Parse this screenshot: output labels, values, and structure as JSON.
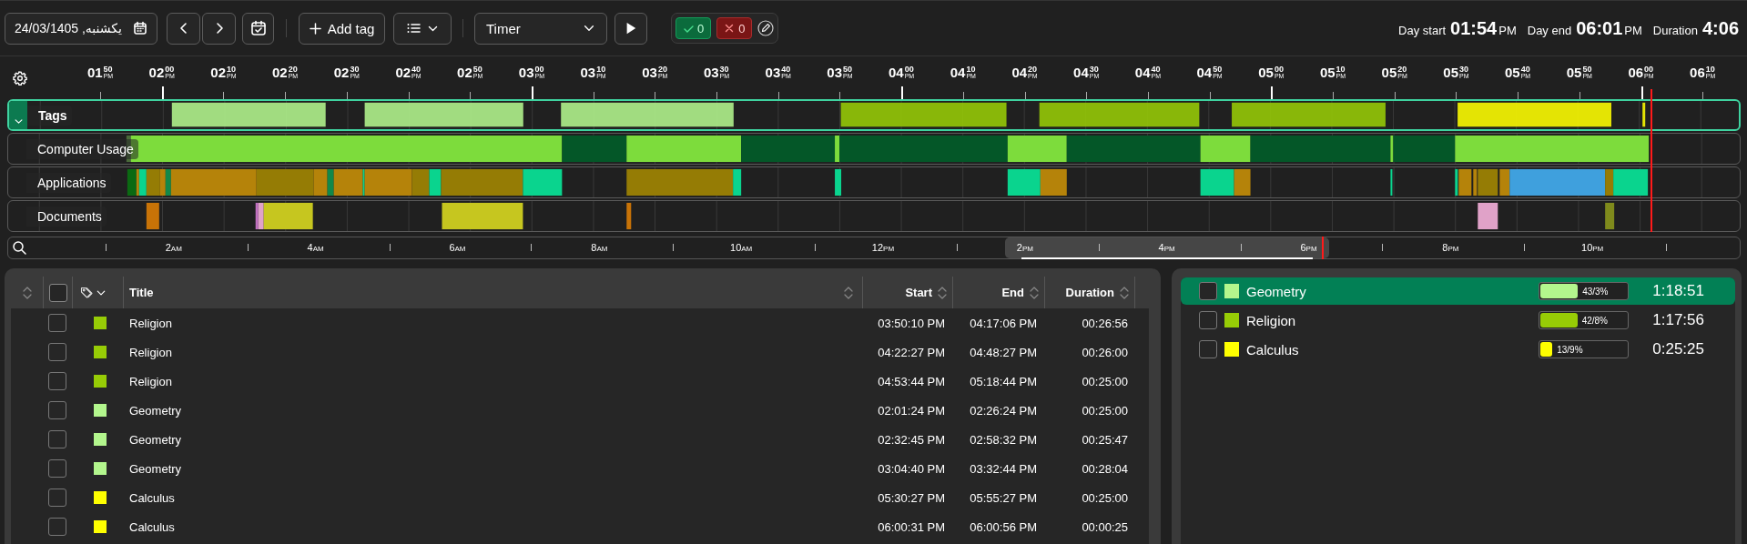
{
  "toolbar": {
    "date": "یکشنبه, 24/03/1405",
    "add_tag": "Add tag",
    "mode": "Timer",
    "approved": "0",
    "rejected": "0"
  },
  "summary": [
    {
      "label": "Day start",
      "value": "01:54",
      "period": "PM"
    },
    {
      "label": "Day end",
      "value": "06:01",
      "period": "PM"
    },
    {
      "label": "Duration",
      "value": "4:06"
    }
  ],
  "timeline": {
    "ticks": [
      {
        "hour": "01",
        "minute": "50",
        "period": "PM"
      },
      {
        "hour": "02",
        "minute": "00",
        "period": "PM"
      },
      {
        "hour": "02",
        "minute": "10",
        "period": "PM"
      },
      {
        "hour": "02",
        "minute": "20",
        "period": "PM"
      },
      {
        "hour": "02",
        "minute": "30",
        "period": "PM"
      },
      {
        "hour": "02",
        "minute": "40",
        "period": "PM"
      },
      {
        "hour": "02",
        "minute": "50",
        "period": "PM"
      },
      {
        "hour": "03",
        "minute": "00",
        "period": "PM"
      },
      {
        "hour": "03",
        "minute": "10",
        "period": "PM"
      },
      {
        "hour": "03",
        "minute": "20",
        "period": "PM"
      },
      {
        "hour": "03",
        "minute": "30",
        "period": "PM"
      },
      {
        "hour": "03",
        "minute": "40",
        "period": "PM"
      },
      {
        "hour": "03",
        "minute": "50",
        "period": "PM"
      },
      {
        "hour": "04",
        "minute": "00",
        "period": "PM"
      },
      {
        "hour": "04",
        "minute": "10",
        "period": "PM"
      },
      {
        "hour": "04",
        "minute": "20",
        "period": "PM"
      },
      {
        "hour": "04",
        "minute": "30",
        "period": "PM"
      },
      {
        "hour": "04",
        "minute": "40",
        "period": "PM"
      },
      {
        "hour": "04",
        "minute": "50",
        "period": "PM"
      },
      {
        "hour": "05",
        "minute": "00",
        "period": "PM"
      },
      {
        "hour": "05",
        "minute": "10",
        "period": "PM"
      },
      {
        "hour": "05",
        "minute": "20",
        "period": "PM"
      },
      {
        "hour": "05",
        "minute": "30",
        "period": "PM"
      },
      {
        "hour": "05",
        "minute": "40",
        "period": "PM"
      },
      {
        "hour": "05",
        "minute": "50",
        "period": "PM"
      },
      {
        "hour": "06",
        "minute": "00",
        "period": "PM"
      },
      {
        "hour": "06",
        "minute": "10",
        "period": "PM"
      }
    ],
    "tracks": [
      {
        "label": "Tags",
        "kind": "tags",
        "selected": true,
        "expanded": true
      },
      {
        "label": "Computer Usage",
        "kind": "usage",
        "selected": false
      },
      {
        "label": "Applications",
        "kind": "applications",
        "selected": false
      },
      {
        "label": "Documents",
        "kind": "documents",
        "selected": false
      }
    ]
  },
  "overview": {
    "labels": [
      {
        "hour": "2",
        "period": "AM"
      },
      {
        "hour": "4",
        "period": "AM"
      },
      {
        "hour": "6",
        "period": "AM"
      },
      {
        "hour": "8",
        "period": "AM"
      },
      {
        "hour": "10",
        "period": "AM"
      },
      {
        "hour": "12",
        "period": "PM"
      },
      {
        "hour": "2",
        "period": "PM"
      },
      {
        "hour": "4",
        "period": "PM"
      },
      {
        "hour": "6",
        "period": "PM"
      },
      {
        "hour": "8",
        "period": "PM"
      },
      {
        "hour": "10",
        "period": "PM"
      }
    ]
  },
  "table": {
    "select_all_checked": false,
    "columns": [
      "Title",
      "Start",
      "End",
      "Duration"
    ],
    "rows": [
      {
        "title": "Religion",
        "color": "#97cc06",
        "start": "03:50:10 PM",
        "end": "04:17:06 PM",
        "duration": "00:26:56",
        "checked": false
      },
      {
        "title": "Religion",
        "color": "#97cc06",
        "start": "04:22:27 PM",
        "end": "04:48:27 PM",
        "duration": "00:26:00",
        "checked": false
      },
      {
        "title": "Religion",
        "color": "#97cc06",
        "start": "04:53:44 PM",
        "end": "05:18:44 PM",
        "duration": "00:25:00",
        "checked": false
      },
      {
        "title": "Geometry",
        "color": "#b3f68d",
        "start": "02:01:24 PM",
        "end": "02:26:24 PM",
        "duration": "00:25:00",
        "checked": false
      },
      {
        "title": "Geometry",
        "color": "#b3f68d",
        "start": "02:32:45 PM",
        "end": "02:58:32 PM",
        "duration": "00:25:47",
        "checked": false
      },
      {
        "title": "Geometry",
        "color": "#b3f68d",
        "start": "03:04:40 PM",
        "end": "03:32:44 PM",
        "duration": "00:28:04",
        "checked": false
      },
      {
        "title": "Calculus",
        "color": "#ffff00",
        "start": "05:30:27 PM",
        "end": "05:55:27 PM",
        "duration": "00:25:00",
        "checked": false
      },
      {
        "title": "Calculus",
        "color": "#ffff00",
        "start": "06:00:31 PM",
        "end": "06:00:56 PM",
        "duration": "00:00:25",
        "checked": false
      }
    ]
  },
  "tag_totals": [
    {
      "name": "Geometry",
      "color": "#b3f68d",
      "selected": true,
      "checked": false,
      "level": 0.433,
      "percent": "43/3%",
      "duration": "1:18:51"
    },
    {
      "name": "Religion",
      "color": "#97cc06",
      "selected": false,
      "checked": false,
      "level": 0.428,
      "percent": "42/8%",
      "duration": "1:17:56"
    },
    {
      "name": "Calculus",
      "color": "#ffff00",
      "selected": false,
      "checked": false,
      "level": 0.139,
      "percent": "13/9%",
      "duration": "0:25:25"
    }
  ]
}
